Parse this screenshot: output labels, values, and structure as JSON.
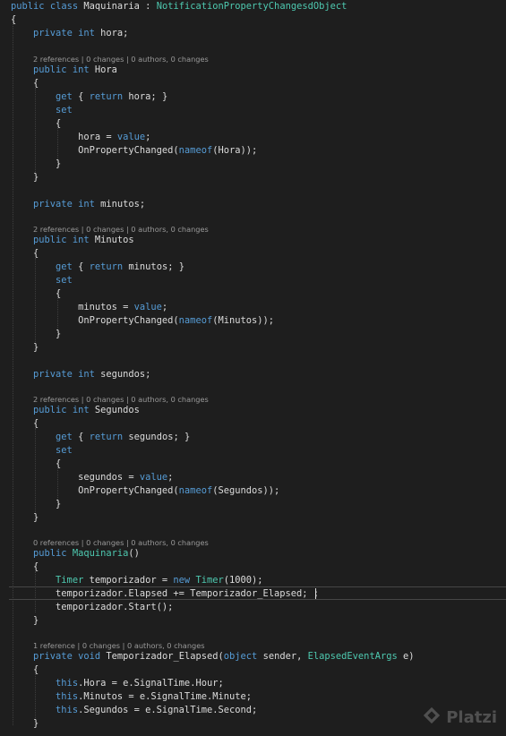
{
  "editor": {
    "lines": [
      [
        [
          "kw",
          "public"
        ],
        [
          "p",
          " "
        ],
        [
          "kw",
          "class"
        ],
        [
          "p",
          " Maquinaria : "
        ],
        [
          "ty",
          "NotificationPropertyChangesdObject"
        ]
      ],
      [
        [
          "p",
          "{"
        ]
      ],
      [
        [
          "p",
          "    "
        ],
        [
          "kw",
          "private"
        ],
        [
          "p",
          " "
        ],
        [
          "kw",
          "int"
        ],
        [
          "p",
          " hora;"
        ]
      ],
      [
        [
          "lens",
          "2 references | 0 changes | 0 authors, 0 changes"
        ]
      ],
      [
        [
          "p",
          "    "
        ],
        [
          "kw",
          "public"
        ],
        [
          "p",
          " "
        ],
        [
          "kw",
          "int"
        ],
        [
          "p",
          " Hora"
        ]
      ],
      [
        [
          "p",
          "    {"
        ]
      ],
      [
        [
          "p",
          "        "
        ],
        [
          "kw",
          "get"
        ],
        [
          "p",
          " { "
        ],
        [
          "kw",
          "return"
        ],
        [
          "p",
          " hora; }"
        ]
      ],
      [
        [
          "p",
          "        "
        ],
        [
          "kw",
          "set"
        ]
      ],
      [
        [
          "p",
          "        {"
        ]
      ],
      [
        [
          "p",
          "            hora = "
        ],
        [
          "kw",
          "value"
        ],
        [
          "p",
          ";"
        ]
      ],
      [
        [
          "p",
          "            OnPropertyChanged("
        ],
        [
          "kw",
          "nameof"
        ],
        [
          "p",
          "(Hora));"
        ]
      ],
      [
        [
          "p",
          "        }"
        ]
      ],
      [
        [
          "p",
          "    }"
        ]
      ],
      [
        [
          "p",
          "    "
        ],
        [
          "kw",
          "private"
        ],
        [
          "p",
          " "
        ],
        [
          "kw",
          "int"
        ],
        [
          "p",
          " minutos;"
        ]
      ],
      [
        [
          "lens",
          "2 references | 0 changes | 0 authors, 0 changes"
        ]
      ],
      [
        [
          "p",
          "    "
        ],
        [
          "kw",
          "public"
        ],
        [
          "p",
          " "
        ],
        [
          "kw",
          "int"
        ],
        [
          "p",
          " Minutos"
        ]
      ],
      [
        [
          "p",
          "    {"
        ]
      ],
      [
        [
          "p",
          "        "
        ],
        [
          "kw",
          "get"
        ],
        [
          "p",
          " { "
        ],
        [
          "kw",
          "return"
        ],
        [
          "p",
          " minutos; }"
        ]
      ],
      [
        [
          "p",
          "        "
        ],
        [
          "kw",
          "set"
        ]
      ],
      [
        [
          "p",
          "        {"
        ]
      ],
      [
        [
          "p",
          "            minutos = "
        ],
        [
          "kw",
          "value"
        ],
        [
          "p",
          ";"
        ]
      ],
      [
        [
          "p",
          "            OnPropertyChanged("
        ],
        [
          "kw",
          "nameof"
        ],
        [
          "p",
          "(Minutos));"
        ]
      ],
      [
        [
          "p",
          "        }"
        ]
      ],
      [
        [
          "p",
          "    }"
        ]
      ],
      [
        [
          "p",
          "    "
        ],
        [
          "kw",
          "private"
        ],
        [
          "p",
          " "
        ],
        [
          "kw",
          "int"
        ],
        [
          "p",
          " segundos;"
        ]
      ],
      [
        [
          "lens",
          "2 references | 0 changes | 0 authors, 0 changes"
        ]
      ],
      [
        [
          "p",
          "    "
        ],
        [
          "kw",
          "public"
        ],
        [
          "p",
          " "
        ],
        [
          "kw",
          "int"
        ],
        [
          "p",
          " Segundos"
        ]
      ],
      [
        [
          "p",
          "    {"
        ]
      ],
      [
        [
          "p",
          "        "
        ],
        [
          "kw",
          "get"
        ],
        [
          "p",
          " { "
        ],
        [
          "kw",
          "return"
        ],
        [
          "p",
          " segundos; }"
        ]
      ],
      [
        [
          "p",
          "        "
        ],
        [
          "kw",
          "set"
        ]
      ],
      [
        [
          "p",
          "        {"
        ]
      ],
      [
        [
          "p",
          "            segundos = "
        ],
        [
          "kw",
          "value"
        ],
        [
          "p",
          ";"
        ]
      ],
      [
        [
          "p",
          "            OnPropertyChanged("
        ],
        [
          "kw",
          "nameof"
        ],
        [
          "p",
          "(Segundos));"
        ]
      ],
      [
        [
          "p",
          "        }"
        ]
      ],
      [
        [
          "p",
          "    }"
        ]
      ],
      [
        [
          "lens",
          "0 references | 0 changes | 0 authors, 0 changes"
        ]
      ],
      [
        [
          "p",
          "    "
        ],
        [
          "kw",
          "public"
        ],
        [
          "p",
          " "
        ],
        [
          "ty",
          "Maquinaria"
        ],
        [
          "p",
          "()"
        ]
      ],
      [
        [
          "p",
          "    {"
        ]
      ],
      [
        [
          "p",
          "        "
        ],
        [
          "ty",
          "Timer"
        ],
        [
          "p",
          " temporizador = "
        ],
        [
          "kw",
          "new"
        ],
        [
          "p",
          " "
        ],
        [
          "ty",
          "Timer"
        ],
        [
          "p",
          "(1000);"
        ]
      ],
      [
        [
          "p",
          "        temporizador.Elapsed += Temporizador_Elapsed; ;"
        ]
      ],
      [
        [
          "p",
          "        temporizador.Start();"
        ]
      ],
      [
        [
          "p",
          "    }"
        ]
      ],
      [
        [
          "lens",
          "1 reference | 0 changes | 0 authors, 0 changes"
        ]
      ],
      [
        [
          "p",
          "    "
        ],
        [
          "kw",
          "private"
        ],
        [
          "p",
          " "
        ],
        [
          "kw",
          "void"
        ],
        [
          "p",
          " Temporizador_Elapsed("
        ],
        [
          "kw",
          "object"
        ],
        [
          "p",
          " sender, "
        ],
        [
          "ty",
          "ElapsedEventArgs"
        ],
        [
          "p",
          " e)"
        ]
      ],
      [
        [
          "p",
          "    {"
        ]
      ],
      [
        [
          "p",
          "        "
        ],
        [
          "kw",
          "this"
        ],
        [
          "p",
          ".Hora = e.SignalTime.Hour;"
        ]
      ],
      [
        [
          "p",
          "        "
        ],
        [
          "kw",
          "this"
        ],
        [
          "p",
          ".Minutos = e.SignalTime.Minute;"
        ]
      ],
      [
        [
          "p",
          "        "
        ],
        [
          "kw",
          "this"
        ],
        [
          "p",
          ".Segundos = e.SignalTime.Second;"
        ]
      ],
      [
        [
          "p",
          "    }"
        ]
      ]
    ]
  },
  "colors": {
    "background": "#1e1e1e",
    "keyword": "#569cd6",
    "type": "#4ec9b0",
    "plain": "#dcdcdc",
    "codelens": "#999999"
  },
  "watermark": {
    "text": "Platzi",
    "icon": "platzi-logo-icon"
  }
}
